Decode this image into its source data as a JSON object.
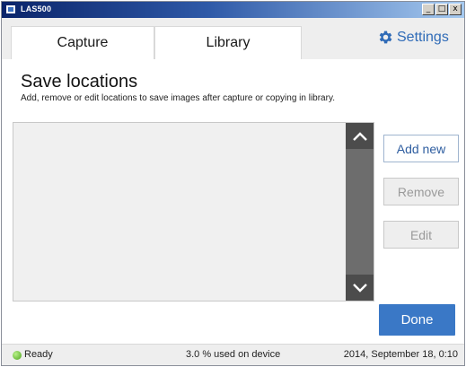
{
  "window": {
    "title": "LAS500",
    "controls": {
      "minimize": "_",
      "maximize": "□",
      "close": "x"
    }
  },
  "tabs": [
    {
      "label": "Capture"
    },
    {
      "label": "Library"
    }
  ],
  "settings": {
    "label": "Settings",
    "icon": "gear-icon",
    "color": "#2f6bb7"
  },
  "main": {
    "title": "Save locations",
    "description": "Add, remove or edit locations to save images after capture or copying in library.",
    "list": {
      "items": []
    },
    "buttons": {
      "add_new": "Add new",
      "remove": "Remove",
      "edit": "Edit",
      "done": "Done"
    }
  },
  "status": {
    "ready": "Ready",
    "usage": "3.0 % used on device",
    "timestamp": "2014, September 18, 0:10",
    "indicator_color": "#4da51d"
  },
  "colors": {
    "accent": "#3a78c6",
    "scrollbar": "#6d6d6d"
  }
}
